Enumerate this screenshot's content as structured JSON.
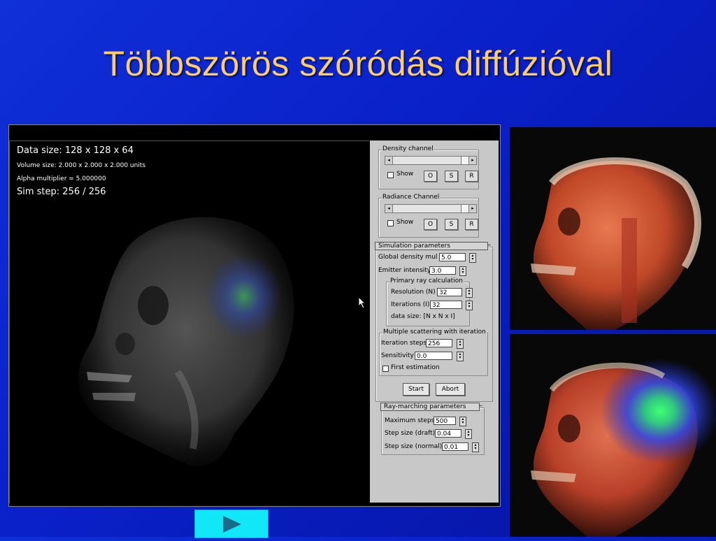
{
  "slide": {
    "title": "Többszörös szóródás diffúzióval"
  },
  "viewport": {
    "data_size": "Data size: 128 x 128 x 64",
    "volume_size": "Volume size: 2.000 x 2.000 x 2.000 units",
    "alpha_multiplier": "Alpha multiplier = 5.000000",
    "sim_step": "Sim step: 256 / 256"
  },
  "density_channel": {
    "title": "Density channel",
    "show_label": "Show",
    "buttons": [
      "O",
      "S",
      "R"
    ]
  },
  "radiance_channel": {
    "title": "Radiance Channel",
    "show_label": "Show",
    "buttons": [
      "O",
      "S",
      "R"
    ]
  },
  "simulation": {
    "title": "Simulation parameters",
    "collapse": "–",
    "global_density_label": "Global density mul",
    "global_density_value": "5.0",
    "emitter_intensity_label": "Emitter intensity",
    "emitter_intensity_value": "3.0",
    "primary": {
      "title": "Primary ray calculation",
      "resolution_label": "Resolution (N)",
      "resolution_value": "32",
      "iterations_label": "Iterations (I)",
      "iterations_value": "32",
      "data_size_label": "data size: [N x N x I]"
    },
    "multiple": {
      "title": "Multiple scattering with iteration",
      "iteration_steps_label": "Iteration steps",
      "iteration_steps_value": "256",
      "sensitivity_label": "Sensitivity",
      "sensitivity_value": "0.0",
      "first_estimation_label": "First estimation"
    },
    "start_label": "Start",
    "abort_label": "Abort"
  },
  "raymarching": {
    "title": "Ray-marching parameters",
    "collapse": "–",
    "max_steps_label": "Maximum steps",
    "max_steps_value": "500",
    "step_draft_label": "Step size (draft)",
    "step_draft_value": "0.04",
    "step_normal_label": "Step size (normal)",
    "step_normal_value": "0.01"
  },
  "icons": {
    "cursor": "mouse-pointer-icon",
    "next": "play-triangle-icon"
  },
  "colors": {
    "title": "#ffcc66",
    "background": "#0a20c8",
    "nav_button": "#10e8f8",
    "nav_triangle": "#1a6a8a"
  }
}
